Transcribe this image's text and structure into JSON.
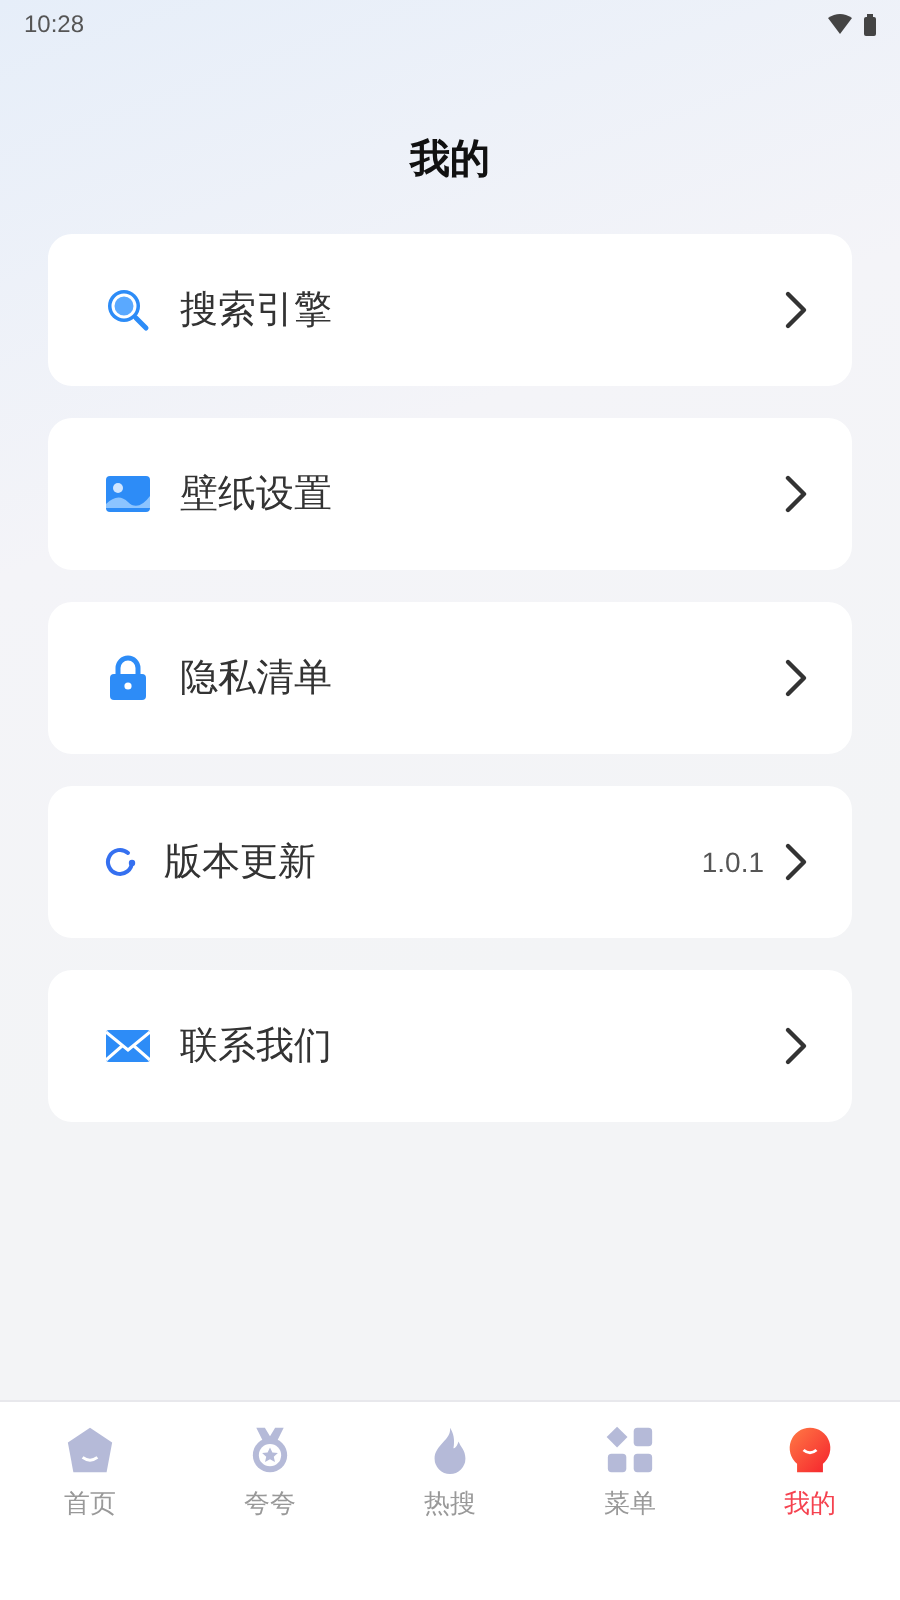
{
  "status_bar": {
    "time": "10:28"
  },
  "title": "我的",
  "menu": [
    {
      "kind": "search",
      "label": "搜索引擎"
    },
    {
      "kind": "wallpaper",
      "label": "壁纸设置"
    },
    {
      "kind": "lock",
      "label": "隐私清单"
    },
    {
      "kind": "update",
      "label": "版本更新",
      "value": "1.0.1"
    },
    {
      "kind": "mail",
      "label": "联系我们"
    }
  ],
  "tabs": [
    {
      "kind": "home",
      "label": "首页",
      "selected": false
    },
    {
      "kind": "medal",
      "label": "夸夸",
      "selected": false
    },
    {
      "kind": "fire",
      "label": "热搜",
      "selected": false
    },
    {
      "kind": "grid",
      "label": "菜单",
      "selected": false
    },
    {
      "kind": "me",
      "label": "我的",
      "selected": true
    }
  ]
}
